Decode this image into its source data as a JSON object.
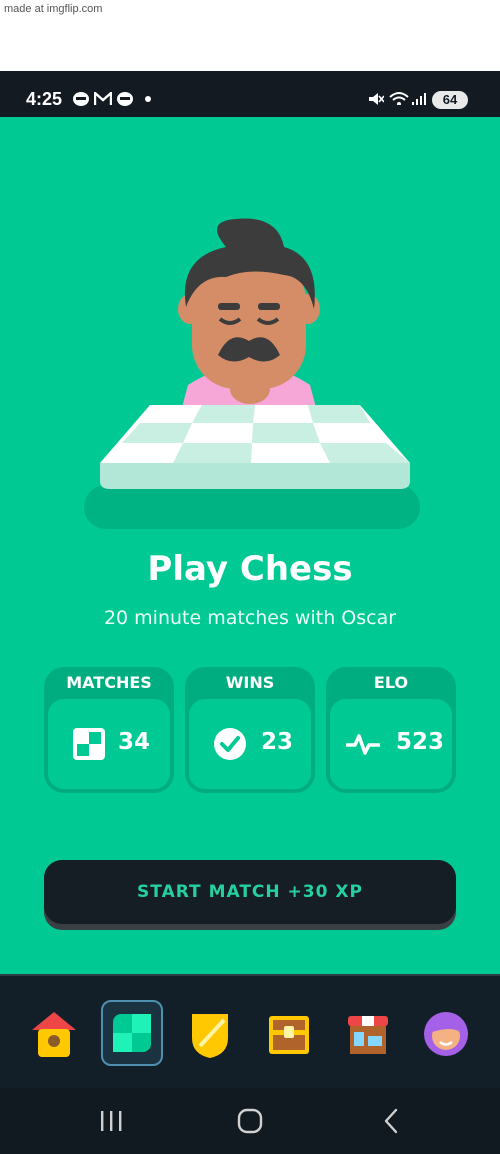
{
  "watermark": "made at imgflip.com",
  "status_bar": {
    "time": "4:25",
    "battery": "64",
    "notification_icons": [
      "news-icon",
      "gmail-icon",
      "news-icon",
      "dot-icon"
    ],
    "system_icons": [
      "mute-icon",
      "wifi-icon",
      "signal-icon",
      "battery-icon"
    ]
  },
  "lesson": {
    "title": "Play Chess",
    "subtitle": "20 minute matches with Oscar",
    "character": "oscar-illustration"
  },
  "stats": [
    {
      "label": "MATCHES",
      "value": "34",
      "icon": "chessboard-icon"
    },
    {
      "label": "WINS",
      "value": "23",
      "icon": "checkmark-icon"
    },
    {
      "label": "ELO",
      "value": "523",
      "icon": "pulse-icon"
    }
  ],
  "cta": {
    "label": "START MATCH +30 XP"
  },
  "tabs": [
    {
      "name": "home",
      "icon": "birdhouse-icon"
    },
    {
      "name": "chess",
      "icon": "chessboard-icon",
      "active": true
    },
    {
      "name": "leagues",
      "icon": "shield-icon"
    },
    {
      "name": "quests",
      "icon": "treasure-chest-icon"
    },
    {
      "name": "shop",
      "icon": "shop-icon"
    },
    {
      "name": "profile",
      "icon": "avatar-icon"
    }
  ],
  "system_nav": [
    "recents-icon",
    "home-circle-icon",
    "back-icon"
  ],
  "colors": {
    "background": "#00c994",
    "card_header": "#00ad80",
    "button": "#151d25",
    "button_text": "#25d09f",
    "tabbar": "#131f28"
  }
}
